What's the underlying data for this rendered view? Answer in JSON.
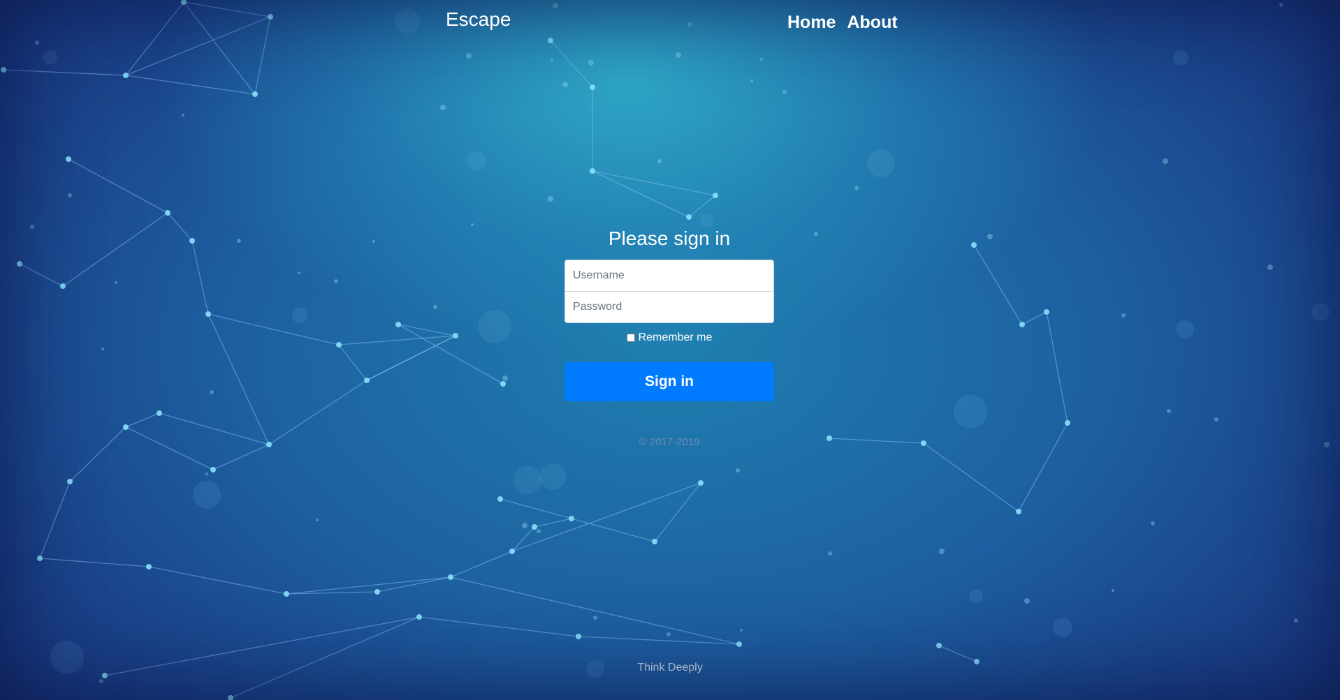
{
  "header": {
    "brand": "Escape",
    "nav": [
      "Home",
      "About"
    ]
  },
  "signin": {
    "title": "Please sign in",
    "username_placeholder": "Username",
    "password_placeholder": "Password",
    "remember_label": "Remember me",
    "submit_label": "Sign in",
    "copyright": "© 2017-2019"
  },
  "footer": {
    "text": "Think Deeply"
  },
  "colors": {
    "accent": "#007bff",
    "background_top": "#2bb3c9",
    "background_bottom": "#1a3a86"
  }
}
